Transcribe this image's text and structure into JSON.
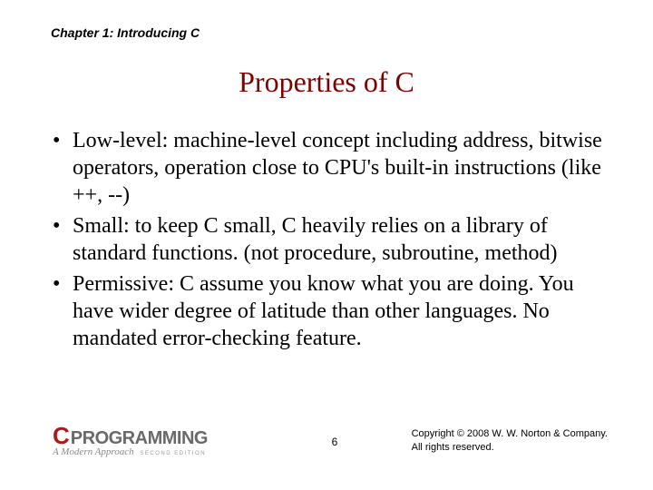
{
  "header": {
    "chapter": "Chapter 1: Introducing C"
  },
  "title": "Properties of C",
  "bullets": [
    "Low-level: machine-level concept including address, bitwise operators, operation close to CPU's built-in instructions (like ++, --)",
    "Small: to keep C small, C heavily relies on a library of standard functions. (not procedure, subroutine, method)",
    "Permissive: C assume you know what you are doing. You have wider degree of latitude than other languages. No mandated error-checking feature."
  ],
  "footer": {
    "logo_c": "C",
    "logo_text": "PROGRAMMING",
    "logo_sub": "A Modern Approach",
    "logo_edition": "SECOND EDITION",
    "page": "6",
    "copyright_line1": "Copyright © 2008 W. W. Norton & Company.",
    "copyright_line2": "All rights reserved."
  }
}
